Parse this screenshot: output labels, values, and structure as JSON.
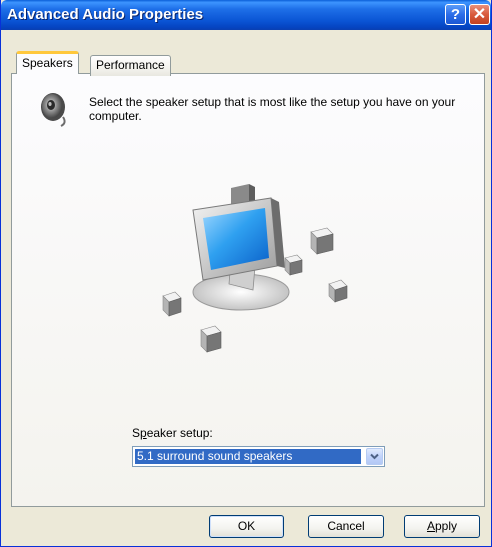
{
  "window": {
    "title": "Advanced Audio Properties",
    "help_glyph": "?",
    "close_glyph": "✕"
  },
  "tabs": [
    {
      "label": "Speakers",
      "selected": true
    },
    {
      "label": "Performance",
      "selected": false
    }
  ],
  "speakers_tab": {
    "icon": "speaker-icon",
    "description": "Select the speaker setup that is most like the setup you have on your computer.",
    "illustration": "monitor-with-surround-speakers",
    "setup_label_prefix": "S",
    "setup_label_accel": "p",
    "setup_label_rest": "eaker setup:",
    "setup_value": "5.1 surround sound speakers"
  },
  "buttons": {
    "ok": "OK",
    "cancel": "Cancel",
    "apply_accel": "A",
    "apply_rest": "pply"
  },
  "colors": {
    "titlebar": "#0a54d4",
    "selected_tab_accent": "#ffc83c",
    "selection": "#316ac5",
    "dialog_bg": "#ece9d8"
  }
}
